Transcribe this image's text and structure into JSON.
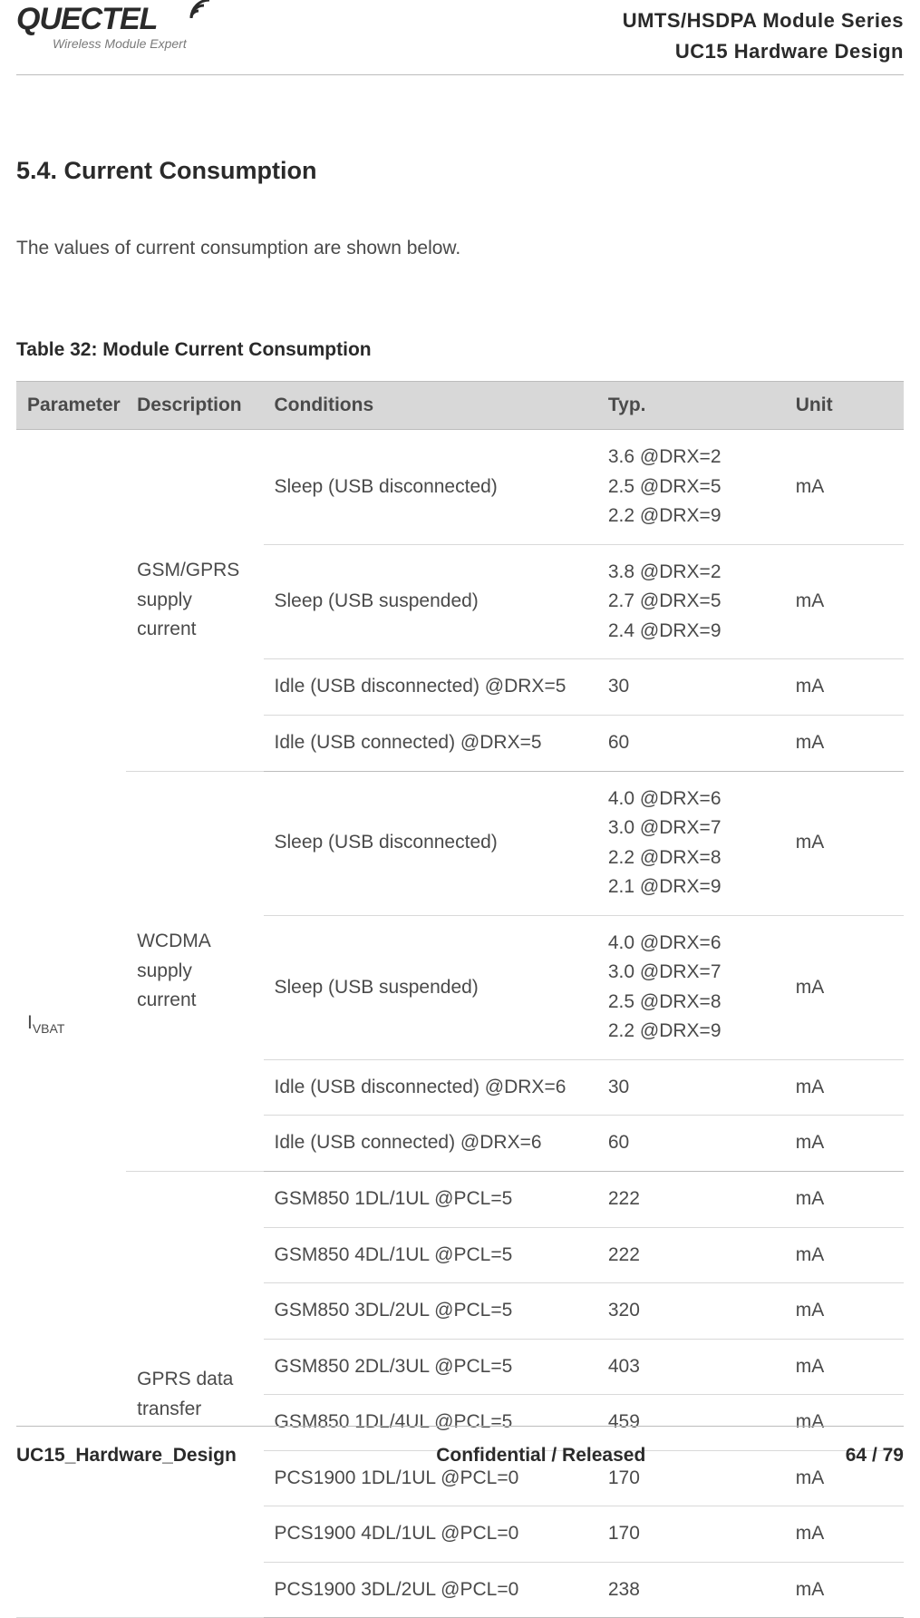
{
  "header": {
    "logo_text": "QUECTEL",
    "logo_tagline": "Wireless Module Expert",
    "right_line1": "UMTS/HSDPA Module Series",
    "right_line2": "UC15 Hardware Design"
  },
  "section_title": "5.4. Current Consumption",
  "intro": "The values of current consumption are shown below.",
  "table_caption": "Table 32: Module Current Consumption",
  "columns": {
    "parameter": "Parameter",
    "description": "Description",
    "conditions": "Conditions",
    "typ": "Typ.",
    "unit": "Unit"
  },
  "parameter": {
    "label_prefix": "I",
    "label_sub": "VBAT"
  },
  "groups": [
    {
      "description": "GSM/GPRS supply current",
      "rows": [
        {
          "conditions": "Sleep (USB disconnected)",
          "typ": "3.6 @DRX=2\n2.5 @DRX=5\n2.2 @DRX=9",
          "unit": "mA"
        },
        {
          "conditions": "Sleep (USB suspended)",
          "typ": "3.8 @DRX=2\n2.7 @DRX=5\n2.4 @DRX=9",
          "unit": "mA"
        },
        {
          "conditions": "Idle (USB disconnected) @DRX=5",
          "typ": "30",
          "unit": "mA"
        },
        {
          "conditions": "Idle (USB connected) @DRX=5",
          "typ": "60",
          "unit": "mA"
        }
      ]
    },
    {
      "description": "WCDMA supply current",
      "rows": [
        {
          "conditions": "Sleep (USB disconnected)",
          "typ": "4.0 @DRX=6\n3.0 @DRX=7\n2.2 @DRX=8\n2.1 @DRX=9",
          "unit": "mA"
        },
        {
          "conditions": "Sleep (USB suspended)",
          "typ": "4.0 @DRX=6\n3.0 @DRX=7\n2.5 @DRX=8\n2.2 @DRX=9",
          "unit": "mA"
        },
        {
          "conditions": "Idle (USB disconnected) @DRX=6",
          "typ": "30",
          "unit": "mA"
        },
        {
          "conditions": "Idle (USB connected) @DRX=6",
          "typ": "60",
          "unit": "mA"
        }
      ]
    },
    {
      "description": "GPRS data transfer",
      "rows": [
        {
          "conditions": "GSM850 1DL/1UL @PCL=5",
          "typ": "222",
          "unit": "mA"
        },
        {
          "conditions": "GSM850 4DL/1UL @PCL=5",
          "typ": "222",
          "unit": "mA"
        },
        {
          "conditions": "GSM850 3DL/2UL @PCL=5",
          "typ": "320",
          "unit": "mA"
        },
        {
          "conditions": "GSM850 2DL/3UL @PCL=5",
          "typ": "403",
          "unit": "mA"
        },
        {
          "conditions": "GSM850 1DL/4UL @PCL=5",
          "typ": "459",
          "unit": "mA"
        },
        {
          "conditions": "PCS1900 1DL/1UL @PCL=0",
          "typ": "170",
          "unit": "mA"
        },
        {
          "conditions": "PCS1900 4DL/1UL @PCL=0",
          "typ": "170",
          "unit": "mA"
        },
        {
          "conditions": "PCS1900 3DL/2UL @PCL=0",
          "typ": "238",
          "unit": "mA"
        }
      ]
    }
  ],
  "footer": {
    "left": "UC15_Hardware_Design",
    "center": "Confidential / Released",
    "right": "64 / 79"
  }
}
